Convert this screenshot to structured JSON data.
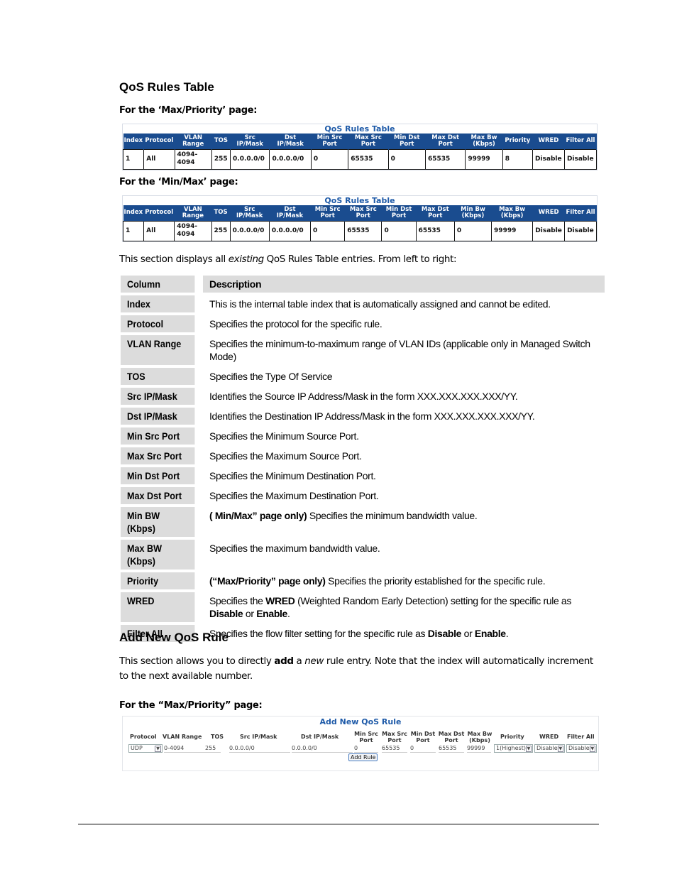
{
  "section1": {
    "heading": "QoS Rules Table",
    "max_priority_label": "For the ‘Max/Priority’ page:",
    "min_max_label": "For the ‘Min/Max’ page:",
    "intro_pre": "This section displays all ",
    "intro_em": "existing",
    "intro_post": " QoS Rules Table entries. From left to right:"
  },
  "table_max_priority": {
    "title": "QoS Rules Table",
    "headers": [
      "Index",
      "Protocol",
      "VLAN Range",
      "TOS",
      "Src IP/Mask",
      "Dst IP/Mask",
      "Min Src Port",
      "Max Src Port",
      "Min Dst Port",
      "Max Dst Port",
      "Max Bw (Kbps)",
      "Priority",
      "WRED",
      "Filter All"
    ],
    "row": [
      "1",
      "All",
      "4094-4094",
      "255",
      "0.0.0.0/0",
      "0.0.0.0/0",
      "0",
      "65535",
      "0",
      "65535",
      "99999",
      "8",
      "Disable",
      "Disable"
    ]
  },
  "table_min_max": {
    "title": "QoS Rules Table",
    "headers": [
      "Index",
      "Protocol",
      "VLAN Range",
      "TOS",
      "Src IP/Mask",
      "Dst IP/Mask",
      "Min Src Port",
      "Max Src Port",
      "Min Dst Port",
      "Max Dst Port",
      "Min Bw (Kbps)",
      "Max Bw (Kbps)",
      "WRED",
      "Filter All"
    ],
    "row": [
      "1",
      "All",
      "4094-4094",
      "255",
      "0.0.0.0/0",
      "0.0.0.0/0",
      "0",
      "65535",
      "0",
      "65535",
      "0",
      "99999",
      "Disable",
      "Disable"
    ]
  },
  "desc_table": {
    "header_column": "Column",
    "header_description": "Description",
    "rows": [
      {
        "col": "Index",
        "desc": "This is the internal table index that is automatically assigned and cannot be edited."
      },
      {
        "col": "Protocol",
        "desc": "Specifies the protocol for the specific rule."
      },
      {
        "col": "VLAN Range",
        "desc": "Specifies the minimum-to-maximum range of VLAN IDs (applicable only in Managed Switch Mode)"
      },
      {
        "col": "TOS",
        "desc": "Specifies the Type Of Service"
      },
      {
        "col": "Src IP/Mask",
        "desc": "Identifies the Source IP Address/Mask in the form XXX.XXX.XXX.XXX/YY."
      },
      {
        "col": "Dst IP/Mask",
        "desc": "Identifies the Destination IP Address/Mask in the form XXX.XXX.XXX.XXX/YY."
      },
      {
        "col": "Min Src Port",
        "desc": "Specifies the Minimum Source Port."
      },
      {
        "col": "Max Src Port",
        "desc": "Specifies the Maximum Source Port."
      },
      {
        "col": "Min Dst Port",
        "desc": "Specifies the Minimum Destination Port."
      },
      {
        "col": "Max Dst Port",
        "desc": "Specifies the Maximum Destination Port."
      },
      {
        "col": "Min BW (Kbps)",
        "desc_bold": "( Min/Max” page only)",
        "desc": " Specifies the minimum bandwidth value."
      },
      {
        "col": "Max BW (Kbps)",
        "desc": "Specifies the maximum bandwidth value."
      },
      {
        "col": "Priority",
        "desc_bold": "(“Max/Priority” page only)",
        "desc": " Specifies the priority established for the specific rule."
      },
      {
        "col": "WRED",
        "parts": [
          "Specifies the ",
          "WRED",
          " (Weighted Random Early Detection) setting for the specific rule as ",
          "Disable",
          " or ",
          "Enable",
          "."
        ]
      },
      {
        "col": "Filter All",
        "parts": [
          "Specifies the flow filter setting for the specific rule as ",
          "Disable",
          " or ",
          "Enable",
          "."
        ]
      }
    ]
  },
  "section2": {
    "heading": "Add New QoS Rule",
    "intro_1": "This section allows you to directly ",
    "intro_bold": "add",
    "intro_2": " a ",
    "intro_em": "new",
    "intro_3": " rule entry. Note that the index will automatically increment to the next available number.",
    "max_priority_label": "For the “Max/Priority” page:"
  },
  "add_form": {
    "title": "Add New QoS Rule",
    "headers": {
      "protocol": "Protocol",
      "vlan": "VLAN Range",
      "tos": "TOS",
      "src": "Src IP/Mask",
      "dst": "Dst IP/Mask",
      "min_src": "Min Src Port",
      "max_src": "Max Src Port",
      "min_dst": "Min Dst Port",
      "max_dst": "Max Dst Port",
      "max_bw": "Max Bw (Kbps)",
      "priority": "Priority",
      "wred": "WRED",
      "filter": "Filter All"
    },
    "values": {
      "protocol": "UDP",
      "vlan": "0-4094",
      "tos": "255",
      "src": "0.0.0.0/0",
      "dst": "0.0.0.0/0",
      "min_src": "0",
      "max_src": "65535",
      "min_dst": "0",
      "max_dst": "65535",
      "max_bw": "99999",
      "priority": "1(Highest)",
      "wred": "Disable",
      "filter": "Disable"
    },
    "add_button": "Add Rule"
  }
}
